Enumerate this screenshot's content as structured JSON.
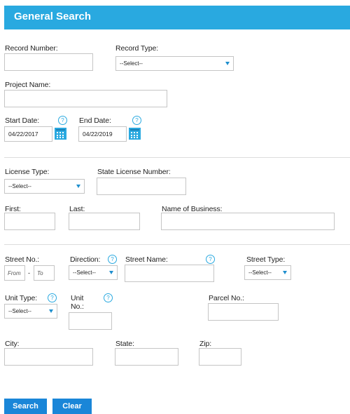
{
  "header": {
    "title": "General Search"
  },
  "labels": {
    "record_number": "Record Number:",
    "record_type": "Record Type:",
    "project_name": "Project Name:",
    "start_date": "Start Date:",
    "end_date": "End Date:",
    "license_type": "License Type:",
    "state_license_number": "State License Number:",
    "first": "First:",
    "last": "Last:",
    "name_of_business": "Name of Business:",
    "street_no": "Street No.:",
    "direction": "Direction:",
    "street_name": "Street Name:",
    "street_type": "Street Type:",
    "unit_type": "Unit Type:",
    "unit_no_line1": "Unit",
    "unit_no_line2": "No.:",
    "parcel_no": "Parcel No.:",
    "city": "City:",
    "state": "State:",
    "zip": "Zip:"
  },
  "fields": {
    "start_date": "04/22/2017",
    "end_date": "04/22/2019",
    "street_from_placeholder": "From",
    "street_to_placeholder": "To",
    "street_range_separator": "-"
  },
  "selects": {
    "record_type": "--Select--",
    "license_type": "--Select--",
    "direction": "--Select--",
    "street_type": "--Select--",
    "unit_type": "--Select--"
  },
  "help_glyph": "?",
  "buttons": {
    "search": "Search",
    "clear": "Clear"
  },
  "colors": {
    "accent": "#29a9e0",
    "button": "#1a86d8"
  }
}
